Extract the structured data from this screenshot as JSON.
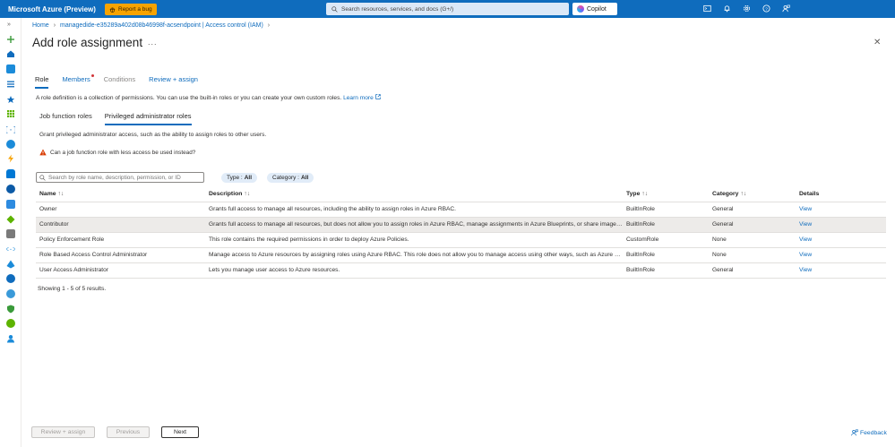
{
  "topbar": {
    "brand": "Microsoft Azure (Preview)",
    "report_bug": "Report a bug",
    "search_placeholder": "Search resources, services, and docs (G+/)",
    "copilot": "Copilot",
    "icons": [
      "cloud-shell-icon",
      "bell-icon",
      "gear-icon",
      "help-icon",
      "feedback-person-icon"
    ]
  },
  "breadcrumb": {
    "items": [
      "Home",
      "managedide-e35289a402d08b46998f-acsendpoint | Access control (IAM)"
    ]
  },
  "page": {
    "title": "Add role assignment",
    "more": "...",
    "close": "✕"
  },
  "tabs": [
    {
      "label": "Role",
      "state": "active"
    },
    {
      "label": "Members",
      "state": "link"
    },
    {
      "label": "Conditions",
      "state": "disabled"
    },
    {
      "label": "Review + assign",
      "state": "link"
    }
  ],
  "description": {
    "text": "A role definition is a collection of permissions. You can use the built-in roles or you can create your own custom roles.",
    "learn_more": "Learn more"
  },
  "subtabs": [
    {
      "label": "Job function roles",
      "active": false
    },
    {
      "label": "Privileged administrator roles",
      "active": true
    }
  ],
  "grant_text": "Grant privileged administrator access, such as the ability to assign roles to other users.",
  "warning_text": "Can a job function role with less access be used instead?",
  "filter": {
    "placeholder": "Search by role name, description, permission, or ID",
    "type_label": "Type :",
    "type_value": "All",
    "category_label": "Category :",
    "category_value": "All"
  },
  "table": {
    "headers": {
      "name": "Name",
      "description": "Description",
      "type": "Type",
      "category": "Category",
      "details": "Details"
    },
    "rows": [
      {
        "name": "Owner",
        "description": "Grants full access to manage all resources, including the ability to assign roles in Azure RBAC.",
        "type": "BuiltInRole",
        "category": "General",
        "details": "View"
      },
      {
        "name": "Contributor",
        "description": "Grants full access to manage all resources, but does not allow you to assign roles in Azure RBAC, manage assignments in Azure Blueprints, or share image galleries.",
        "type": "BuiltInRole",
        "category": "General",
        "details": "View"
      },
      {
        "name": "Policy Enforcement Role",
        "description": "This role contains the required permissions in order to deploy Azure Policies.",
        "type": "CustomRole",
        "category": "None",
        "details": "View"
      },
      {
        "name": "Role Based Access Control Administrator",
        "description": "Manage access to Azure resources by assigning roles using Azure RBAC. This role does not allow you to manage access using other ways, such as Azure Policy.",
        "type": "BuiltInRole",
        "category": "None",
        "details": "View"
      },
      {
        "name": "User Access Administrator",
        "description": "Lets you manage user access to Azure resources.",
        "type": "BuiltInRole",
        "category": "General",
        "details": "View"
      }
    ],
    "selected_row": 1
  },
  "showing": "Showing 1 - 5 of 5 results.",
  "footer": {
    "review_assign": "Review + assign",
    "previous": "Previous",
    "next": "Next",
    "feedback": "Feedback"
  },
  "colors": {
    "accent": "#0f6cbd",
    "bug": "#f7a300",
    "warning": "#d83b01",
    "notify_dot": "#d13438"
  }
}
